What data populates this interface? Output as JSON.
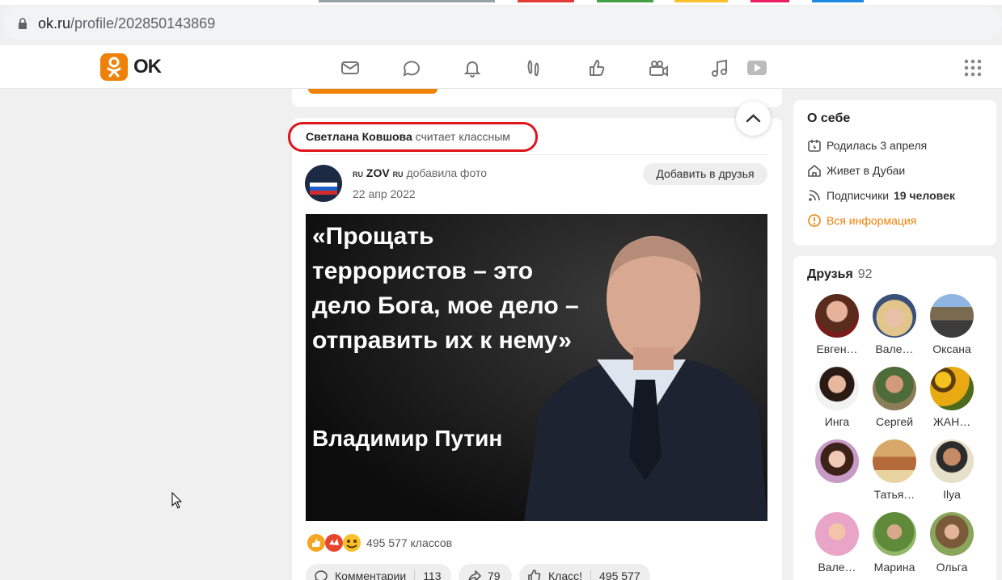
{
  "browser": {
    "url_host": "ok.ru",
    "url_path": "/profile/202850143869"
  },
  "header": {
    "logo_text": "OK",
    "nav_icons": [
      "mail-icon",
      "chat-icon",
      "bell-icon",
      "guests-icon",
      "like-icon",
      "video-camera-icon",
      "music-icon",
      "video-play-icon"
    ],
    "apps_icon": "grid-icon",
    "accent_color": "#ee8208"
  },
  "feed": {
    "liker_name": "Светлана Ковшова",
    "liker_action": "считает классным",
    "author_flag_left": "RU",
    "author_name": "ZOV",
    "author_flag_right": "RU",
    "author_action": "добавила фото",
    "post_date": "22 апр 2022",
    "add_friend_label": "Добавить в друзья",
    "quote_text": "«Прощать террористов – это дело Бога, мое дело – отправить их к нему»",
    "quote_author": "Владимир Путин",
    "class_count": "495 577 классов",
    "actions": {
      "comments_label": "Комментарии",
      "comments_count": "113",
      "shares_count": "79",
      "class_label": "Класс!",
      "class_count": "495 577"
    },
    "highlight_color": "#e0141c"
  },
  "about": {
    "heading": "О себе",
    "birthday": "Родилась 3 апреля",
    "lives": "Живет в Дубаи",
    "subscribers_label": "Подписчики",
    "subscribers_value": "19 человек",
    "all_info": "Вся информация"
  },
  "friends": {
    "heading": "Друзья",
    "count": "92",
    "list": [
      {
        "name": "Евген…"
      },
      {
        "name": "Вале…"
      },
      {
        "name": "Оксана"
      },
      {
        "name": "Инга"
      },
      {
        "name": "Сергей"
      },
      {
        "name": "ЖАН…"
      },
      {
        "name": ""
      },
      {
        "name": "Татья…"
      },
      {
        "name": "Ilya"
      },
      {
        "name": "Вале…"
      },
      {
        "name": "Марина"
      },
      {
        "name": "Ольга"
      }
    ]
  }
}
